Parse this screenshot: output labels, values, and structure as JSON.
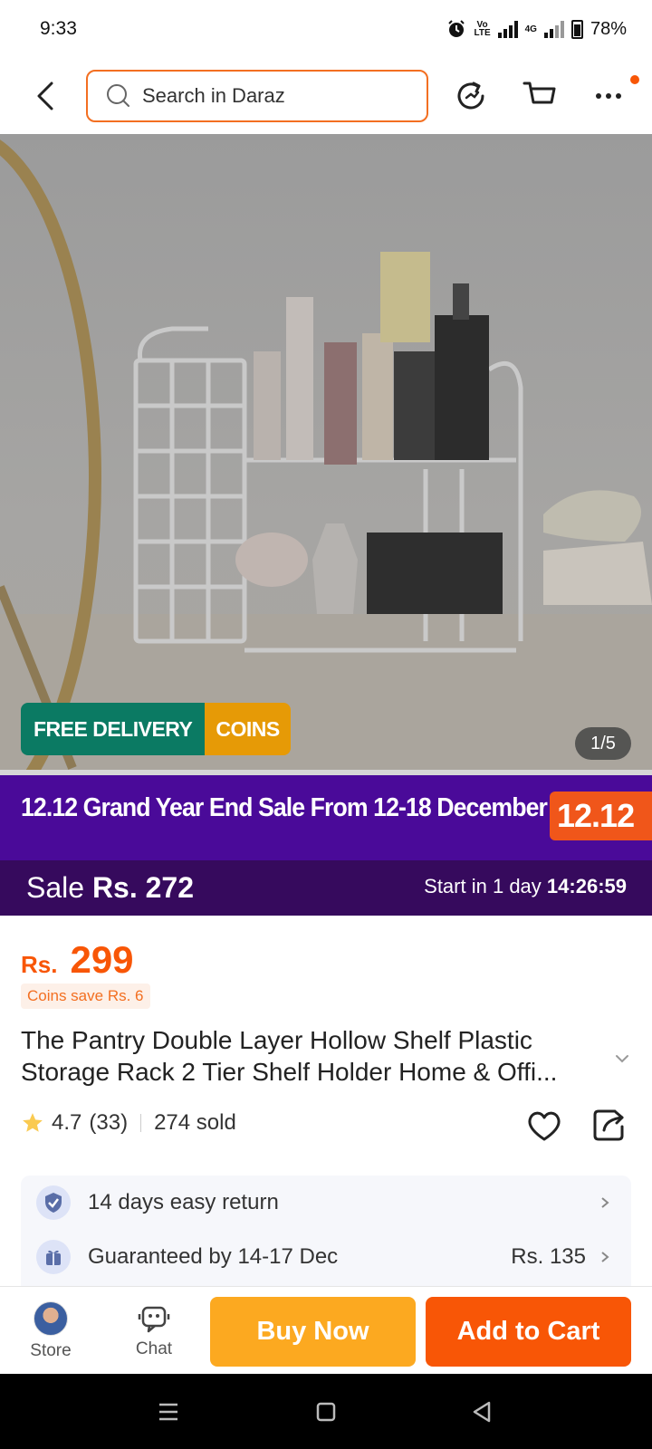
{
  "status_bar": {
    "time": "9:33",
    "volte": "Vo\nLTE",
    "network": "4G",
    "battery": "78%"
  },
  "nav": {
    "search_placeholder": "Search in Daraz"
  },
  "hero": {
    "badge_free_delivery": "FREE DELIVERY",
    "badge_coins": "COINS",
    "image_counter": "1/5"
  },
  "promo": {
    "banner_text": "12.12 Grand Year End Sale From 12-18 December",
    "banner_badge": "12.12",
    "sale_label": "Sale",
    "sale_price": "Rs. 272",
    "start_label": "Start in",
    "start_days": "1 day",
    "start_timer": "14:26:59"
  },
  "product": {
    "currency": "Rs.",
    "price": "299",
    "coins_save": "Coins save Rs. 6",
    "title": "The Pantry Double Layer Hollow Shelf Plastic Storage Rack 2 Tier Shelf Holder Home & Offi...",
    "rating": "4.7",
    "review_count": "(33)",
    "sold": "274 sold"
  },
  "services": [
    {
      "icon": "shield-check-icon",
      "text": "14 days easy return",
      "value": ""
    },
    {
      "icon": "gift-box-icon",
      "text": "Guaranteed by 14-17 Dec",
      "value": "Rs. 135"
    }
  ],
  "bottom_bar": {
    "store_label": "Store",
    "chat_label": "Chat",
    "buy_now": "Buy Now",
    "add_to_cart": "Add to Cart"
  },
  "colors": {
    "brand_orange": "#f85606",
    "buy_now": "#fca920",
    "promo_purple": "#4a0a99",
    "sale_purple": "#360a5d",
    "free_delivery_green": "#0b7a63"
  }
}
